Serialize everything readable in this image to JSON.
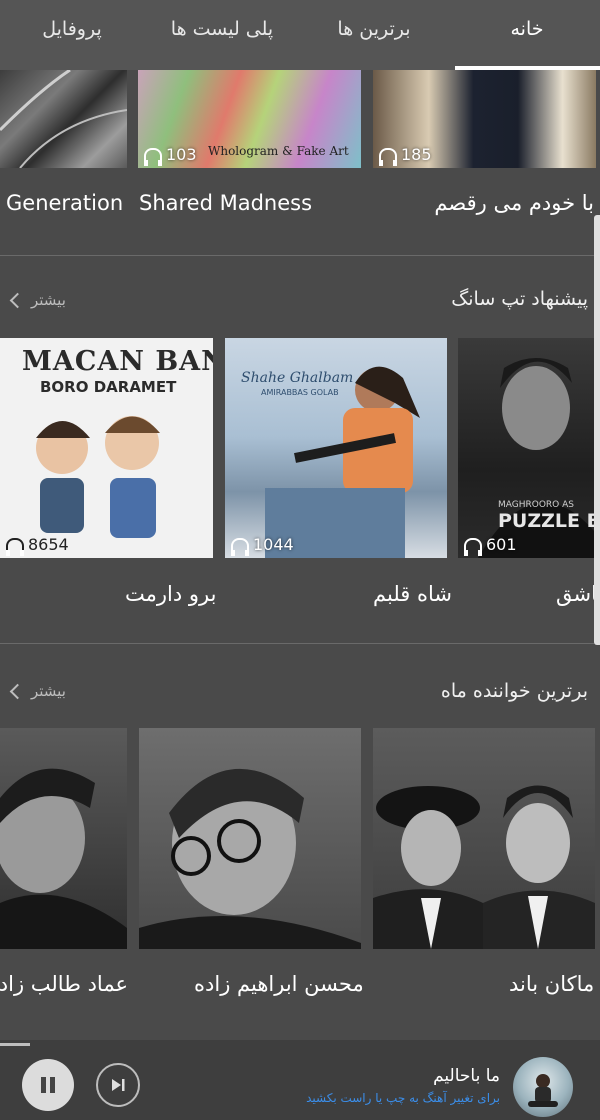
{
  "tabs": {
    "home": "خانه",
    "top": "برترین ها",
    "playlists": "پلی لیست ها",
    "profile": "پروفایل"
  },
  "row1": {
    "cards": [
      {
        "title": "Generation",
        "count": ""
      },
      {
        "title": "Shared Madness",
        "count": "103",
        "image_text": "Whologram & Fake Art"
      },
      {
        "title": "با خودم می رقصم",
        "count": "185"
      }
    ]
  },
  "top_song": {
    "title": "پیشنهاد تپ سانگ",
    "more": "بیشتر",
    "cards": [
      {
        "title": "برو دارمت",
        "count": "8654",
        "art_line1": "MACAN BAND",
        "art_line2": "BORO DARAMET"
      },
      {
        "title": "شاه قلبم",
        "count": "1044",
        "art_line1": "Shahe Ghalbam",
        "art_line2": "AMIRABBAS GOLAB"
      },
      {
        "title": "عاشق",
        "count": "601",
        "art_line1": "PUZZLE BAND",
        "art_line2": "MAGHROORO AS"
      }
    ]
  },
  "top_artist": {
    "title": "برترین خواننده ماه",
    "more": "بیشتر",
    "cards": [
      {
        "name": "عماد طالب زاده"
      },
      {
        "name": "محسن ابراهیم زاده"
      },
      {
        "name": "ماکان باند"
      }
    ]
  },
  "player": {
    "track": "ما باحالیم",
    "hint": "برای تغییر آهنگ به چپ یا راست بکشید",
    "progress": 0.05
  },
  "colors": {
    "background": "#4a4a4a",
    "tabs_bg": "#555555",
    "hint_blue": "#3b8eea"
  }
}
